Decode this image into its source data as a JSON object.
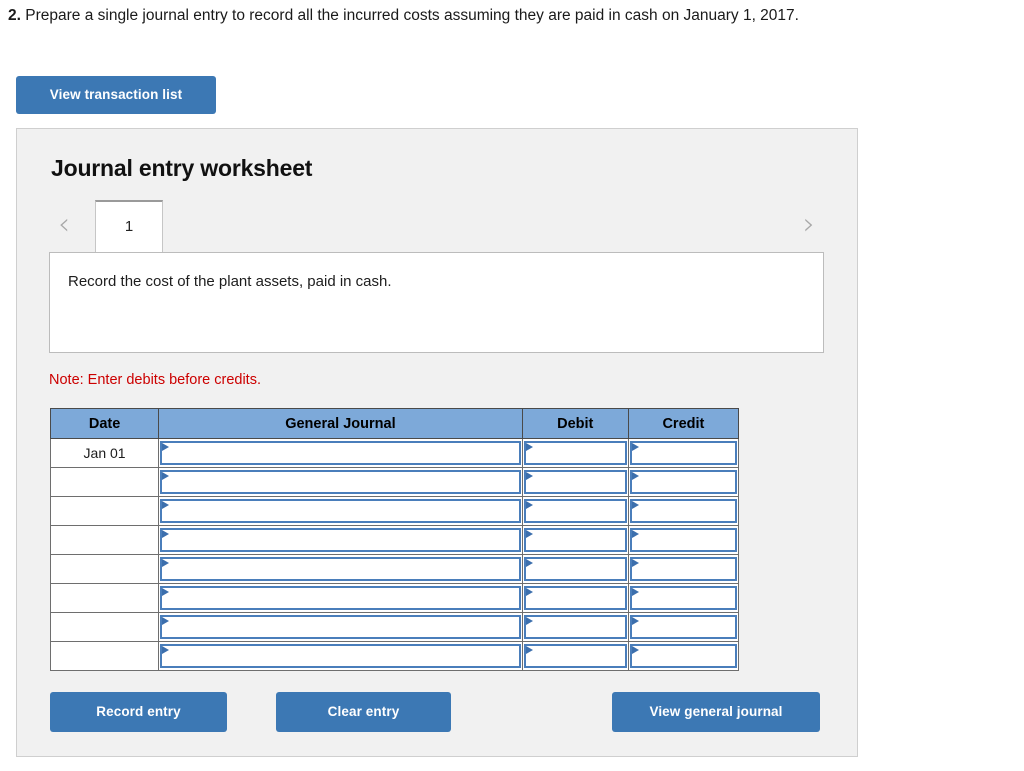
{
  "question": {
    "number": "2.",
    "text": "Prepare a single journal entry to record all the incurred costs assuming they are paid in cash on January 1, 2017."
  },
  "toolbar": {
    "view_transaction_list_label": "View transaction list"
  },
  "panel": {
    "title": "Journal entry worksheet",
    "tabs": {
      "prev_icon": "‹",
      "next_icon": "›",
      "items": [
        {
          "label": "1",
          "selected": true
        }
      ]
    },
    "description": "Record the cost of the plant assets, paid in cash.",
    "note": "Note: Enter debits before credits.",
    "table": {
      "columns": [
        "Date",
        "General Journal",
        "Debit",
        "Credit"
      ],
      "rows": [
        {
          "date": "Jan 01",
          "general_journal": "",
          "debit": "",
          "credit": ""
        },
        {
          "date": "",
          "general_journal": "",
          "debit": "",
          "credit": ""
        },
        {
          "date": "",
          "general_journal": "",
          "debit": "",
          "credit": ""
        },
        {
          "date": "",
          "general_journal": "",
          "debit": "",
          "credit": ""
        },
        {
          "date": "",
          "general_journal": "",
          "debit": "",
          "credit": ""
        },
        {
          "date": "",
          "general_journal": "",
          "debit": "",
          "credit": ""
        },
        {
          "date": "",
          "general_journal": "",
          "debit": "",
          "credit": ""
        },
        {
          "date": "",
          "general_journal": "",
          "debit": "",
          "credit": ""
        }
      ]
    },
    "actions": {
      "record_entry_label": "Record entry",
      "clear_entry_label": "Clear entry",
      "view_general_journal_label": "View general journal"
    }
  },
  "colors": {
    "button_blue": "#3c78b4",
    "table_header_blue": "#7da9d9",
    "field_border_blue": "#4a7ebb",
    "note_red": "#cc0000",
    "panel_bg": "#f1f1f1"
  }
}
